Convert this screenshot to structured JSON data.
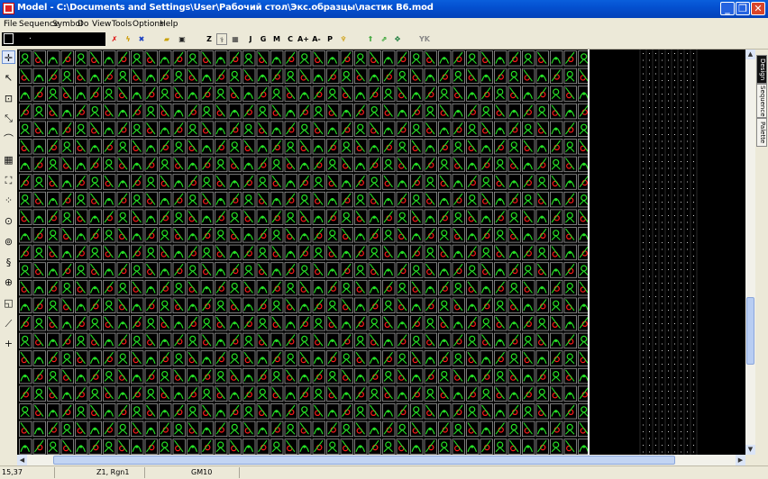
{
  "window": {
    "title": "Model - C:\\Documents and Settings\\User\\Рабочий стол\\Экс.образцы\\ластик B6.mod",
    "minimize": "_",
    "maximize": "❐",
    "close": "✕"
  },
  "menu": [
    "File",
    "Sequence",
    "Symbol",
    "Do",
    "View",
    "Tools",
    "Options",
    "Help"
  ],
  "toolbar": {
    "value": ".",
    "buttons": [
      "Z",
      "J",
      "G",
      "M",
      "C",
      "A+",
      "A-",
      "P",
      "YK"
    ]
  },
  "side_tabs": [
    "Design",
    "Sequence",
    "Palette"
  ],
  "status": {
    "coords": "15,37",
    "position": "Z1, Rgn1",
    "mode": "GM10"
  },
  "colors": {
    "stitch_green": "#26e026",
    "stitch_red": "#ff1a1a",
    "grid_line": "#9a9a9a",
    "canvas_bg": "#000000",
    "accent": "#0a5fdc"
  }
}
